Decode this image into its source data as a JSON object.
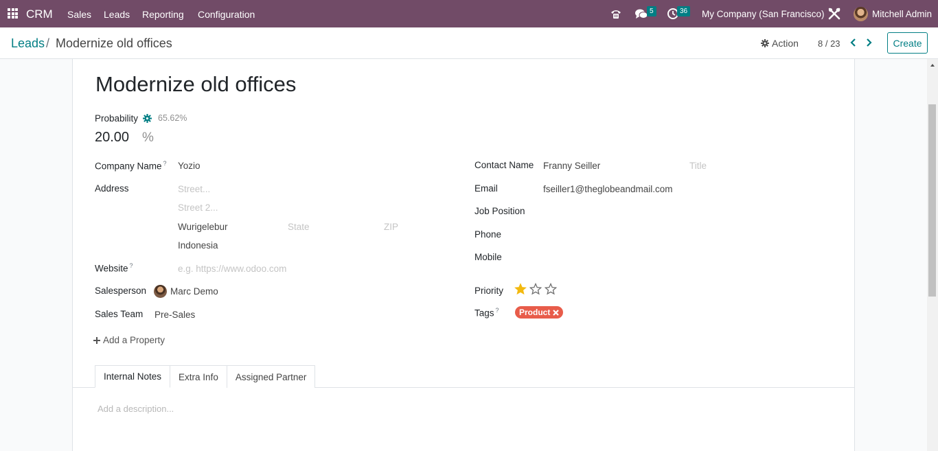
{
  "navbar": {
    "brand": "CRM",
    "menu": [
      "Sales",
      "Leads",
      "Reporting",
      "Configuration"
    ],
    "chat_count": "5",
    "activity_count": "36",
    "company": "My Company (San Francisco)",
    "user": "Mitchell Admin"
  },
  "control": {
    "breadcrumb_root": "Leads",
    "breadcrumb_sep": "/",
    "breadcrumb_current": "Modernize old offices",
    "action_label": "Action",
    "pager": "8 / 23",
    "create_label": "Create"
  },
  "form": {
    "title": "Modernize old offices",
    "probability_label": "Probability",
    "probability_auto": "65.62%",
    "probability_value": "20.00",
    "probability_unit": "%",
    "company_name_label": "Company Name",
    "company_name": "Yozio",
    "address_label": "Address",
    "street_placeholder": "Street...",
    "street2_placeholder": "Street 2...",
    "city": "Wurigelebur",
    "state_placeholder": "State",
    "zip_placeholder": "ZIP",
    "country": "Indonesia",
    "website_label": "Website",
    "website_placeholder": "e.g. https://www.odoo.com",
    "salesperson_label": "Salesperson",
    "salesperson": "Marc Demo",
    "sales_team_label": "Sales Team",
    "sales_team": "Pre-Sales",
    "add_property": "Add a Property",
    "contact_name_label": "Contact Name",
    "contact_name": "Franny Seiller",
    "title_placeholder": "Title",
    "email_label": "Email",
    "email": "fseiller1@theglobeandmail.com",
    "job_position_label": "Job Position",
    "phone_label": "Phone",
    "mobile_label": "Mobile",
    "priority_label": "Priority",
    "priority_stars": 1,
    "priority_max": 3,
    "tags_label": "Tags",
    "tags": [
      "Product"
    ],
    "help_mark": "?"
  },
  "tabs": [
    "Internal Notes",
    "Extra Info",
    "Assigned Partner"
  ],
  "description_placeholder": "Add a description...",
  "colors": {
    "navbar": "#714b67",
    "accent": "#017e84",
    "tag": "#e85c4a",
    "star": "#f3b90f"
  }
}
